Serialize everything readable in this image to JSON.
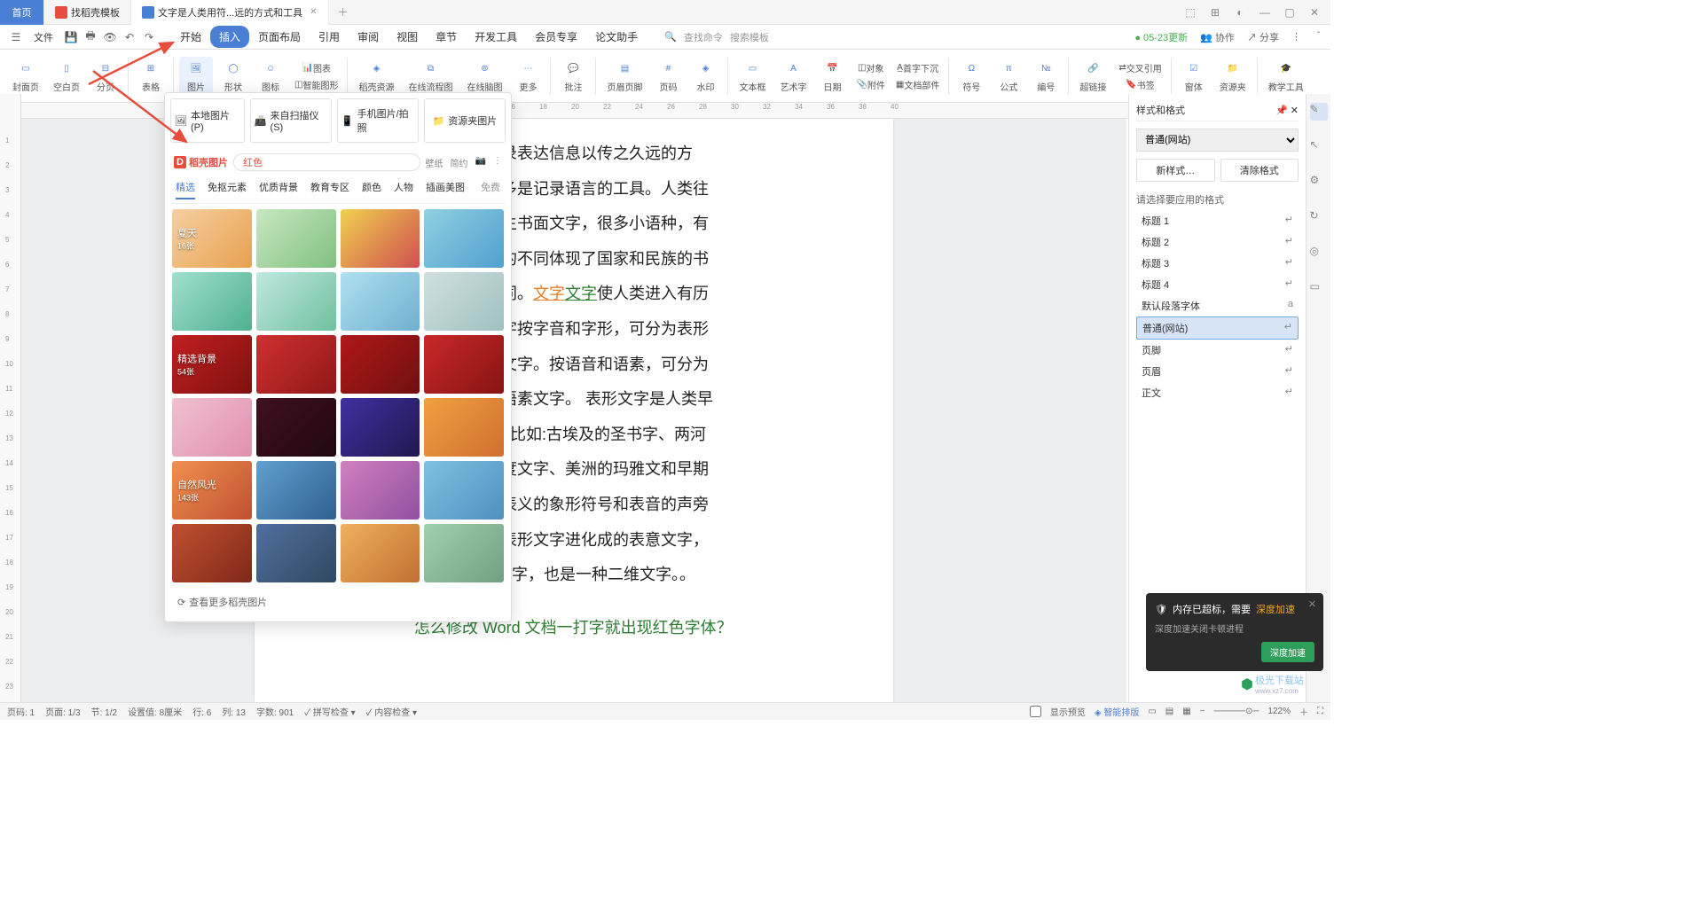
{
  "tabs": {
    "home": "首页",
    "t1": "找稻壳模板",
    "t2": "文字是人类用符...远的方式和工具"
  },
  "winicons": [
    "layout-icon",
    "grid-icon",
    "user-icon",
    "minimize-icon",
    "maximize-icon",
    "close-icon"
  ],
  "file_menu": "文件",
  "menu": [
    "开始",
    "插入",
    "页面布局",
    "引用",
    "审阅",
    "视图",
    "章节",
    "开发工具",
    "会员专享",
    "论文助手"
  ],
  "menu_active_index": 1,
  "search_cmd": "查找命令",
  "search_tpl": "搜索模板",
  "topright": {
    "update": "05-23更新",
    "collab": "协作",
    "share": "分享"
  },
  "ribbon": [
    "封面页",
    "空白页",
    "分页",
    "表格",
    "图片",
    "形状",
    "图标",
    "智能图形",
    "稻壳资源",
    "在线流程图",
    "在线脑图",
    "更多",
    "批注",
    "页眉页脚",
    "页码",
    "水印",
    "文本框",
    "艺术字",
    "日期",
    "附件",
    "文档部件",
    "符号",
    "公式",
    "编号",
    "超链接",
    "书签",
    "窗体",
    "资源夹",
    "教学工具"
  ],
  "ribbon_extra": {
    "chart": "图表",
    "object": "对象",
    "firstdrop": "首字下沉",
    "crossref": "交叉引用"
  },
  "ribbon_hl_index": 4,
  "imgpicker": {
    "opts": [
      "本地图片(P)",
      "来自扫描仪(S)",
      "手机图片/拍照",
      "资源夹图片"
    ],
    "logo": "稻壳图片",
    "search_value": "红色",
    "wallpaper": "壁纸",
    "simple": "简约",
    "tabs": [
      "精选",
      "免抠元素",
      "优质背景",
      "教育专区",
      "颜色",
      "人物",
      "插画美图",
      "免费"
    ],
    "thumbs": [
      {
        "label": "夏天",
        "count": "16张",
        "bg": "linear-gradient(135deg,#f5d0a0,#e8a050)"
      },
      {
        "bg": "linear-gradient(135deg,#c8e8c0,#80c080)"
      },
      {
        "bg": "linear-gradient(135deg,#f0d050,#d05050)"
      },
      {
        "bg": "linear-gradient(135deg,#90d0e0,#50a0d0)"
      },
      {
        "bg": "linear-gradient(135deg,#a0e0d0,#50b090)"
      },
      {
        "bg": "linear-gradient(135deg,#c0e8e0,#70c0a0)"
      },
      {
        "bg": "linear-gradient(135deg,#b0e0f0,#70b0d0)"
      },
      {
        "bg": "linear-gradient(135deg,#d0e0e0,#a0c0c0)"
      },
      {
        "label": "精选背景",
        "count": "54张",
        "bg": "linear-gradient(135deg,#c02020,#801010)"
      },
      {
        "bg": "linear-gradient(135deg,#d03030,#901818)"
      },
      {
        "bg": "linear-gradient(135deg,#b01818,#701010)"
      },
      {
        "bg": "linear-gradient(135deg,#c82828,#881414)"
      },
      {
        "bg": "linear-gradient(135deg,#f0c0d0,#e090b0)"
      },
      {
        "bg": "linear-gradient(135deg,#401020,#200810)"
      },
      {
        "bg": "linear-gradient(135deg,#4030a0,#201850)"
      },
      {
        "bg": "linear-gradient(135deg,#f0a040,#d07030)"
      },
      {
        "label": "自然风光",
        "count": "143张",
        "bg": "linear-gradient(135deg,#f09050,#c05030)"
      },
      {
        "bg": "linear-gradient(135deg,#60a0d0,#306090)"
      },
      {
        "bg": "linear-gradient(135deg,#d080c0,#9050a0)"
      },
      {
        "bg": "linear-gradient(135deg,#80c0e0,#5090c0)"
      },
      {
        "bg": "linear-gradient(135deg,#c05030,#802818)"
      },
      {
        "bg": "linear-gradient(135deg,#5070a0,#304860)"
      },
      {
        "bg": "linear-gradient(135deg,#f0b060,#c07030)"
      },
      {
        "bg": "linear-gradient(135deg,#a0d0b0,#70a080)"
      }
    ],
    "more": "查看更多稻壳图片"
  },
  "doc": {
    "p1_a": "记录表达信息以传之久远的方",
    "p1_b": "大多是记录语言的工具。人类往",
    "p1_c": "产生书面文字，很多小语种，有",
    "p1_d": "字的不同体现了国家和民族的书",
    "p1_e": "不同。",
    "link1": "文字",
    "link2": "文字",
    "p1_f": "使人类进入有历",
    "p2": "文字按字音和字形，可分为表形",
    "p3": "音文字。按语音和语素，可分为",
    "p4": "和语素文字。 表形文字是人类早",
    "p5": "字, 比如:古埃及的圣书字、两河",
    "p6": "印度文字、美洲的玛雅文和早期",
    "p7": "由表义的象形符号和表音的声旁",
    "p8": "由表形文字进化成的表意文字，",
    "p9": "汉字也是语素文字，也是一种二维文字。。",
    "title": "怎么修改 Word 文档一打字就出现红色字体？"
  },
  "rightpanel": {
    "title": "样式和格式",
    "select": "普通(网站)",
    "new": "新样式…",
    "clear": "清除格式",
    "label": "请选择要应用的格式",
    "items": [
      "标题 1",
      "标题 2",
      "标题 3",
      "标题 4",
      "默认段落字体",
      "普通(网站)",
      "页脚",
      "页眉",
      "正文"
    ],
    "sel_index": 5,
    "show": "显示",
    "preview": "显示预览",
    "smart": "智能排版"
  },
  "notif": {
    "title": "内存已超标，需要",
    "link": "深度加速",
    "sub": "深度加速关闭卡顿进程",
    "btn": "深度加速"
  },
  "status": {
    "page": "页码: 1",
    "pages": "页面: 1/3",
    "sec": "节: 1/2",
    "pos": "设置值: 8厘米",
    "row": "行: 6",
    "col": "列: 13",
    "words": "字数: 901",
    "spell": "拼写检查",
    "content": "内容检查",
    "zoom": "122%"
  },
  "watermark": "极光下载站",
  "watermark_url": "www.xz7.com"
}
